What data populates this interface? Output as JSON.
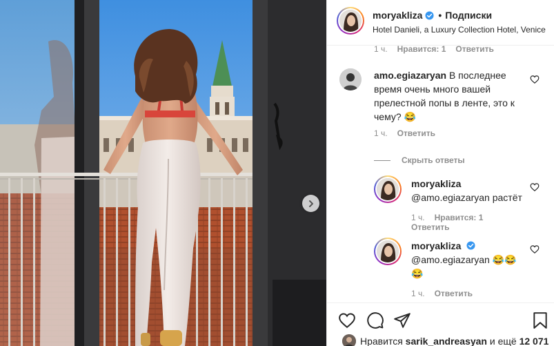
{
  "header": {
    "username": "moryakliza",
    "separator": "•",
    "follow_label": "Подписки",
    "location": "Hotel Danieli, a Luxury Collection Hotel, Venice"
  },
  "colors": {
    "verified_blue": "#3897f0",
    "meta_gray": "#8e8e8e",
    "text": "#262626"
  },
  "top_cut_comment": {
    "time": "1 ч.",
    "likes": "Нравится: 1",
    "reply": "Ответить"
  },
  "comment_main": {
    "username": "amo.egiazaryan",
    "text_line1": "В последнее",
    "text_line2": "время очень много вашей",
    "text_line3": "прелестной попы в ленте, это к",
    "text_line4": "чему? 😂",
    "time": "1 ч.",
    "reply": "Ответить",
    "hide_replies": "Скрыть ответы"
  },
  "replies": [
    {
      "username": "moryakliza",
      "mention": "@amo.egiazaryan",
      "text": "растёт",
      "time": "1 ч.",
      "likes": "Нравится: 1",
      "reply": "Ответить"
    },
    {
      "username": "moryakliza",
      "mention": "@amo.egiazaryan",
      "emoji_line1": "😂😂",
      "emoji_line2": "😂",
      "time": "1 ч.",
      "reply": "Ответить"
    }
  ],
  "icons": {
    "like": "heart-icon",
    "comment": "comment-icon",
    "share": "share-icon",
    "save": "bookmark-icon",
    "next": "chevron-right-icon"
  },
  "likes_line": {
    "prefix": "Нравится",
    "user": "sarik_andreasyan",
    "middle": "и ещё",
    "count": "12 071"
  }
}
